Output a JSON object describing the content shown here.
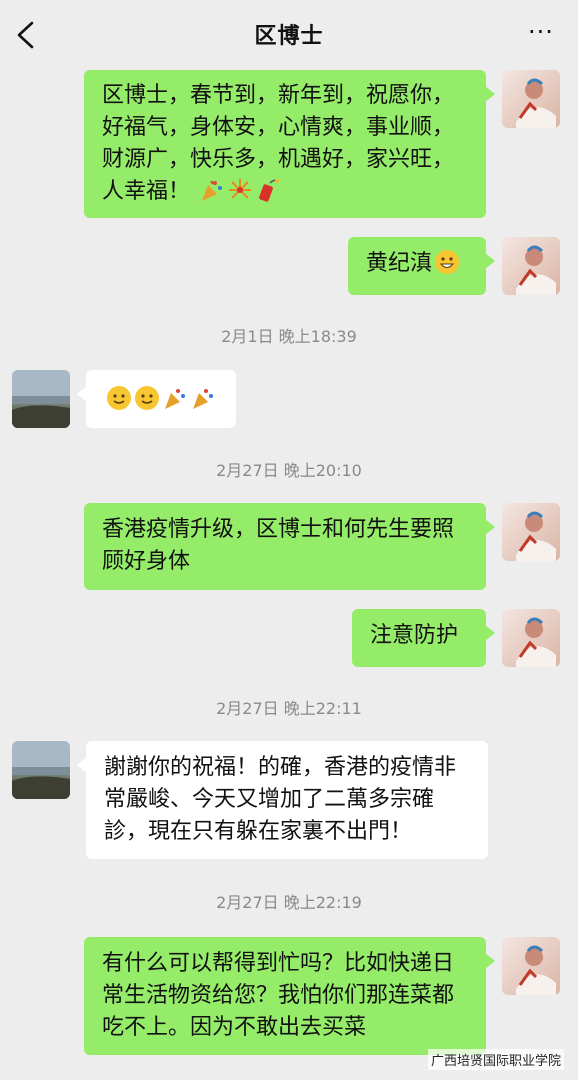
{
  "header": {
    "title": "区博士",
    "more_label": "···"
  },
  "messages": [
    {
      "side": "out",
      "text": "区博士，春节到，新年到，祝愿你，好福气，身体安，心情爽，事业顺，财源广，快乐多，机遇好，家兴旺，人幸福！",
      "emojis": [
        "party-popper",
        "fireworks",
        "firecracker"
      ]
    },
    {
      "side": "out",
      "text": "黄纪滇",
      "emojis": [
        "grinning-face"
      ]
    },
    {
      "side": "in",
      "text": "",
      "emojis": [
        "smiling-face",
        "smiling-face",
        "party-popper",
        "party-popper"
      ]
    },
    {
      "side": "out",
      "text": "香港疫情升级，区博士和何先生要照顾好身体",
      "emojis": []
    },
    {
      "side": "out",
      "text": "注意防护",
      "emojis": []
    },
    {
      "side": "in",
      "text": "謝謝你的祝福！的確，香港的疫情非常嚴峻、今天又增加了二萬多宗確診，現在只有躲在家裏不出門！",
      "emojis": []
    },
    {
      "side": "out",
      "text": "有什么可以帮得到忙吗？比如快递日常生活物资给您？我怕你们那连菜都吃不上。因为不敢出去买菜",
      "emojis": []
    }
  ],
  "timestamps": [
    "2月1日 晚上18:39",
    "2月27日 晚上20:10",
    "2月27日 晚上22:11",
    "2月27日 晚上22:19"
  ],
  "watermark": "广西培贤国际职业学院",
  "colors": {
    "background": "#ededed",
    "outgoing_bubble": "#95ec69",
    "incoming_bubble": "#ffffff",
    "timestamp": "#8a8a8a"
  }
}
